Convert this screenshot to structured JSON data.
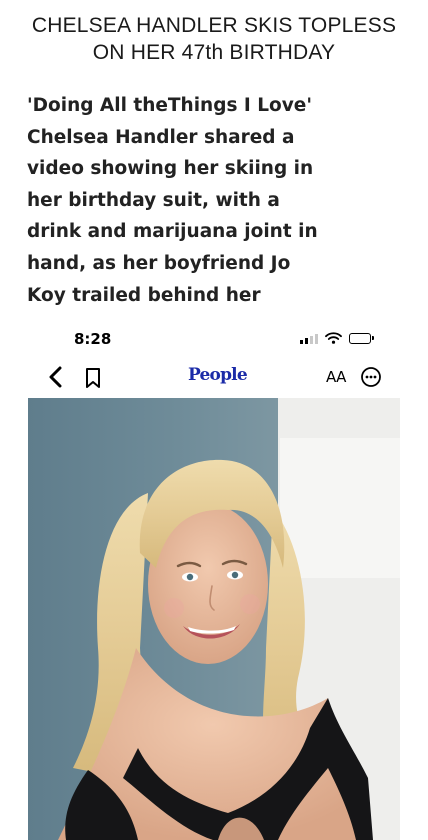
{
  "headline": {
    "line1": "CHELSEA HANDLER SKIS TOPLESS",
    "line2": "ON HER 47th BIRTHDAY"
  },
  "quote": {
    "lines": [
      "'Doing All theThings I Love'",
      "Chelsea Handler shared a",
      "video showing her skiing in",
      "her birthday suit, with a",
      "drink and marijuana joint in",
      "hand, as her boyfriend Jo",
      "Koy trailed behind her"
    ]
  },
  "phone": {
    "status_bar": {
      "time": "8:28",
      "icons": [
        "signal-icon",
        "wifi-icon",
        "battery-icon"
      ]
    },
    "nav": {
      "back_icon": "chevron-left-icon",
      "bookmark_icon": "bookmark-icon",
      "logo": "People",
      "text_size_label": "AA",
      "more_icon": "more-icon"
    },
    "colors": {
      "logo": "#1b2ba8",
      "photo_background": "#6e8a98",
      "hair": "#e6cf9c",
      "dress": "#151517"
    }
  }
}
